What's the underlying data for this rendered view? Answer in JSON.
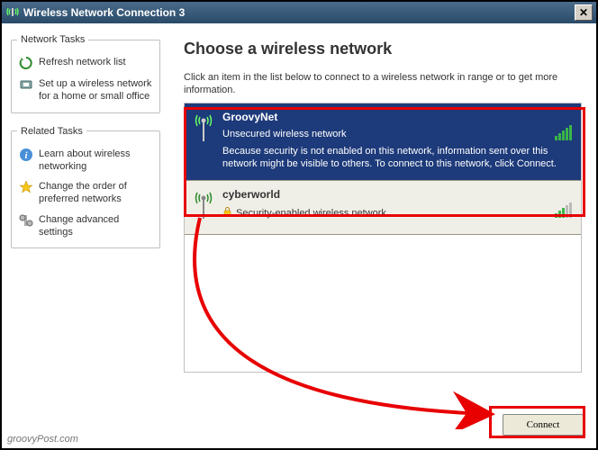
{
  "window": {
    "title": "Wireless Network Connection 3"
  },
  "sidebar": {
    "groups": [
      {
        "title": "Network Tasks",
        "items": [
          {
            "label": "Refresh network list",
            "icon": "refresh-icon"
          },
          {
            "label": "Set up a wireless network for a home or small office",
            "icon": "setup-icon"
          }
        ]
      },
      {
        "title": "Related Tasks",
        "items": [
          {
            "label": "Learn about wireless networking",
            "icon": "info-icon"
          },
          {
            "label": "Change the order of preferred networks",
            "icon": "star-icon"
          },
          {
            "label": "Change advanced settings",
            "icon": "settings-icon"
          }
        ]
      }
    ]
  },
  "main": {
    "heading": "Choose a wireless network",
    "subtext": "Click an item in the list below to connect to a wireless network in range or to get more information.",
    "networks": [
      {
        "name": "GroovyNet",
        "security": "Unsecured wireless network",
        "description": "Because security is not enabled on this network, information sent over this network might be visible to others. To connect to this network, click Connect.",
        "selected": true,
        "signal": "full"
      },
      {
        "name": "cyberworld",
        "security": "Security-enabled wireless network",
        "description": "",
        "selected": false,
        "signal": "low",
        "lock": true
      }
    ],
    "connect_label": "Connect"
  },
  "watermark": "groovyPost.com"
}
